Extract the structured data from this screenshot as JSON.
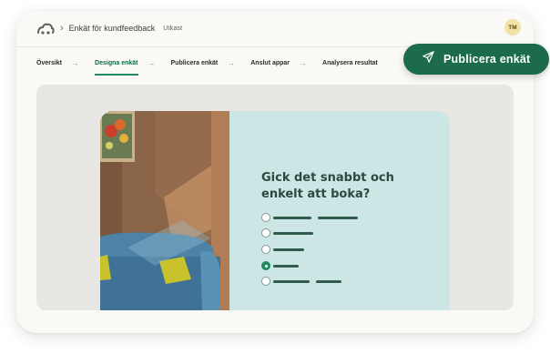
{
  "header": {
    "breadcrumb": "Enkät för kundfeedback",
    "status": "Utkast",
    "avatar_initials": "TM",
    "logo_icon": "cloud-logo-icon",
    "separator_icon": "chevron-right-icon"
  },
  "tabs": [
    {
      "label": "Översikt",
      "active": false
    },
    {
      "label": "Designa enkät",
      "active": true
    },
    {
      "label": "Publicera enkät",
      "active": false
    },
    {
      "label": "Anslut appar",
      "active": false
    },
    {
      "label": "Analysera resultat",
      "active": false
    }
  ],
  "tab_separator_icon": "arrow-right-icon",
  "publish_button": {
    "label": "Publicera enkät",
    "icon": "send-icon"
  },
  "survey": {
    "question": "Gick det snabbt och enkelt att boka?",
    "options": [
      {
        "selected": false
      },
      {
        "selected": false
      },
      {
        "selected": false
      },
      {
        "selected": true
      },
      {
        "selected": false
      }
    ]
  },
  "colors": {
    "accent": "#1c6b4b",
    "active_tab": "#0e6a4c",
    "panel": "#cce6e6",
    "canvas": "#e8e7e3",
    "question_text": "#2a4a3e"
  }
}
